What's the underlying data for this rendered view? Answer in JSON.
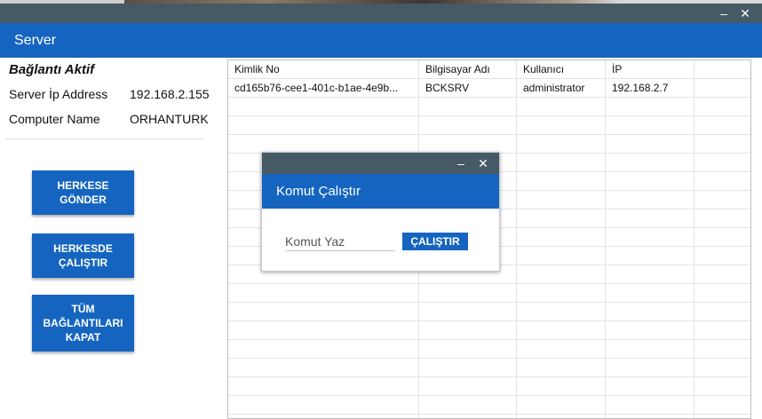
{
  "window": {
    "minimize_glyph": "–",
    "close_glyph": "✕"
  },
  "header": {
    "title": "Server"
  },
  "left": {
    "status": "Bağlantı Aktif",
    "server_ip_label": "Server İp Address",
    "server_ip_value": "192.168.2.155",
    "computer_name_label": "Computer Name",
    "computer_name_value": "ORHANTURK",
    "buttons": [
      {
        "label": "HERKESE\nGÖNDER"
      },
      {
        "label": "HERKESDE\nÇALIŞTIR"
      },
      {
        "label": "TÜM\nBAĞLANTILARI\nKAPAT"
      }
    ]
  },
  "grid": {
    "columns": [
      "Kimlik No",
      "Bilgisayar Adı",
      "Kullanıcı",
      "İP",
      ""
    ],
    "rows": [
      [
        "cd165b76-cee1-401c-b1ae-4e9b...",
        "BCKSRV",
        "administrator",
        "192.168.2.7",
        ""
      ]
    ]
  },
  "dialog": {
    "minimize_glyph": "–",
    "close_glyph": "✕",
    "title": "Komut Çalıştır",
    "input_placeholder": "Komut Yaz",
    "run_label": "ÇALIŞTIR"
  },
  "colors": {
    "titlebar": "#455a64",
    "header": "#1565c0",
    "accent_button": "#1565c0"
  }
}
